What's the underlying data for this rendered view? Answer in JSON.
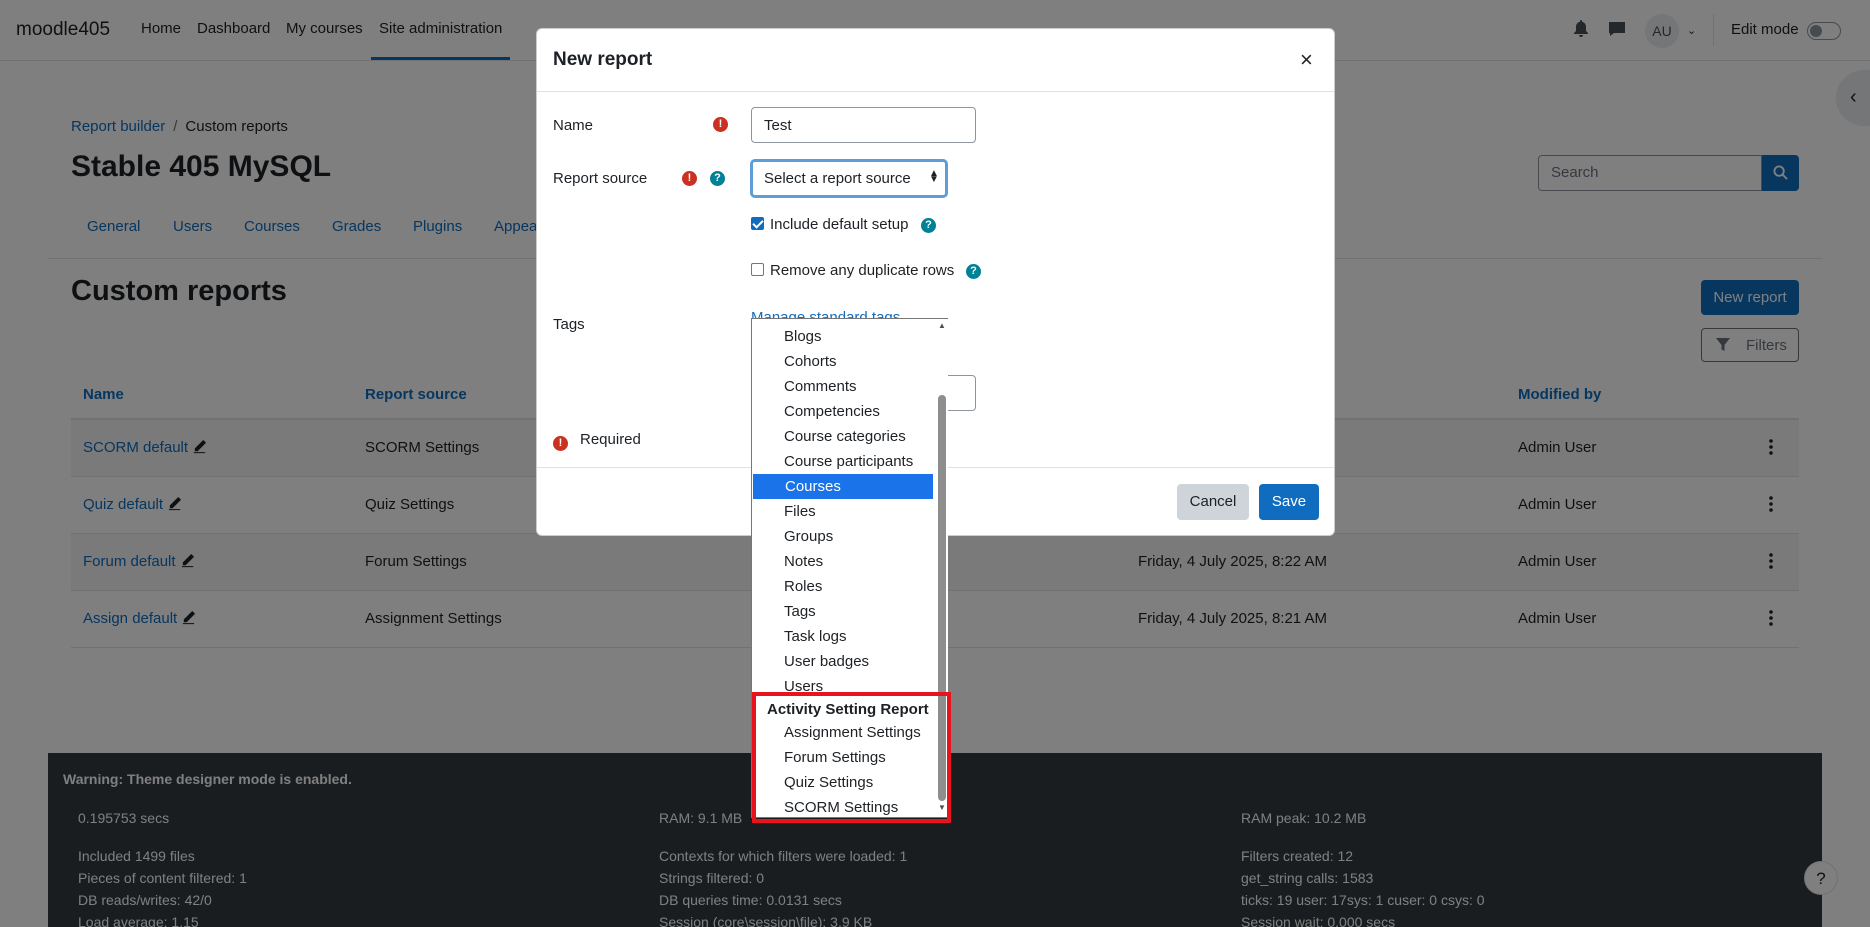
{
  "navbar": {
    "brand": "moodle405",
    "items": [
      "Home",
      "Dashboard",
      "My courses",
      "Site administration"
    ],
    "avatar_initials": "AU",
    "edit_mode_label": "Edit mode"
  },
  "breadcrumb": [
    "Report builder",
    "Custom reports"
  ],
  "page_title": "Stable 405 MySQL",
  "search_placeholder": "Search",
  "tabs": [
    "General",
    "Users",
    "Courses",
    "Grades",
    "Plugins",
    "Appea"
  ],
  "section_title": "Custom reports",
  "buttons": {
    "new_report": "New report",
    "filters": "Filters"
  },
  "table": {
    "headers": {
      "name": "Name",
      "source": "Report source",
      "modified_by": "Modified by"
    },
    "rows": [
      {
        "name": "SCORM default",
        "source": "SCORM Settings",
        "modified": "",
        "modified_by": "Admin User"
      },
      {
        "name": "Quiz default",
        "source": "Quiz Settings",
        "modified": "",
        "modified_by": "Admin User"
      },
      {
        "name": "Forum default",
        "source": "Forum Settings",
        "modified": "Friday, 4 July 2025, 8:22 AM",
        "modified_by": "Admin User"
      },
      {
        "name": "Assign default",
        "source": "Assignment Settings",
        "modified": "Friday, 4 July 2025, 8:21 AM",
        "modified_by": "Admin User"
      }
    ]
  },
  "footer": {
    "warning": "Warning: Theme designer mode is enabled.",
    "col1": [
      "0.195753 secs",
      "",
      "Included 1499 files",
      "Pieces of content filtered: 1",
      "DB reads/writes: 42/0",
      "Load average: 1.15"
    ],
    "col2": [
      "RAM: 9.1 MB",
      "",
      "Contexts for which filters were loaded: 1",
      "Strings filtered: 0",
      "DB queries time: 0.0131 secs",
      "Session (core\\session\\file): 3.9 KB"
    ],
    "col3": [
      "RAM peak: 10.2 MB",
      "",
      "Filters created: 12",
      "get_string calls: 1583",
      "ticks: 19 user: 17sys: 1 cuser: 0 csys: 0",
      "Session wait: 0.000 secs"
    ]
  },
  "modal": {
    "title": "New report",
    "close": "×",
    "name_label": "Name",
    "name_value": "Test",
    "source_label": "Report source",
    "source_value": "Select a report source",
    "include_default_setup": "Include default setup",
    "remove_duplicates": "Remove any duplicate rows",
    "tags_label": "Tags",
    "manage_tags": "Manage standard tags",
    "required": "Required",
    "cancel": "Cancel",
    "save": "Save"
  },
  "dropdown": {
    "items": [
      "Blogs",
      "Cohorts",
      "Comments",
      "Competencies",
      "Course categories",
      "Course participants",
      "Courses",
      "Files",
      "Groups",
      "Notes",
      "Roles",
      "Tags",
      "Task logs",
      "User badges",
      "Users"
    ],
    "selected": "Courses",
    "group_label": "Activity Setting Report",
    "group_items": [
      "Assignment Settings",
      "Forum Settings",
      "Quiz Settings",
      "SCORM Settings"
    ],
    "highlight_color": "#e8131b"
  },
  "colors": {
    "primary": "#0f6cbf",
    "danger": "#ca3120",
    "info": "#008196",
    "footer_bg": "#343a40"
  }
}
